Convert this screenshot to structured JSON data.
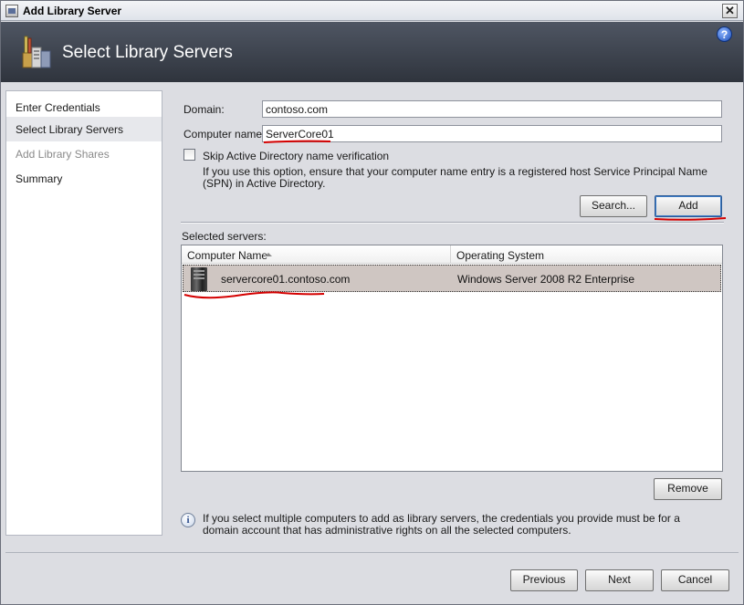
{
  "window": {
    "title": "Add Library Server"
  },
  "header": {
    "title": "Select Library Servers"
  },
  "nav": {
    "items": [
      {
        "label": "Enter Credentials",
        "state": "normal"
      },
      {
        "label": "Select Library Servers",
        "state": "selected"
      },
      {
        "label": "Add Library Shares",
        "state": "disabled"
      },
      {
        "label": "Summary",
        "state": "normal"
      }
    ]
  },
  "form": {
    "domain_label": "Domain:",
    "domain_value": "contoso.com",
    "computer_label": "Computer name:",
    "computer_value": "ServerCore01",
    "skip_label": "Skip Active Directory name verification",
    "skip_note": "If you use this option, ensure that your computer name entry is a registered host Service Principal Name (SPN) in Active Directory.",
    "search_button": "Search...",
    "add_button": "Add"
  },
  "selected": {
    "label": "Selected servers:",
    "columns": [
      "Computer Name",
      "Operating System"
    ],
    "rows": [
      {
        "name": "servercore01.contoso.com",
        "os": "Windows Server 2008 R2 Enterprise"
      }
    ],
    "remove_button": "Remove"
  },
  "info": {
    "text": "If you select multiple computers to add as library servers, the credentials you provide must be for a domain account that has administrative rights on all the selected computers."
  },
  "footer": {
    "previous": "Previous",
    "next": "Next",
    "cancel": "Cancel"
  },
  "colors": {
    "header_bg": "#3a404b",
    "annotation": "#d40000",
    "selected_row": "#cfc6c2"
  }
}
